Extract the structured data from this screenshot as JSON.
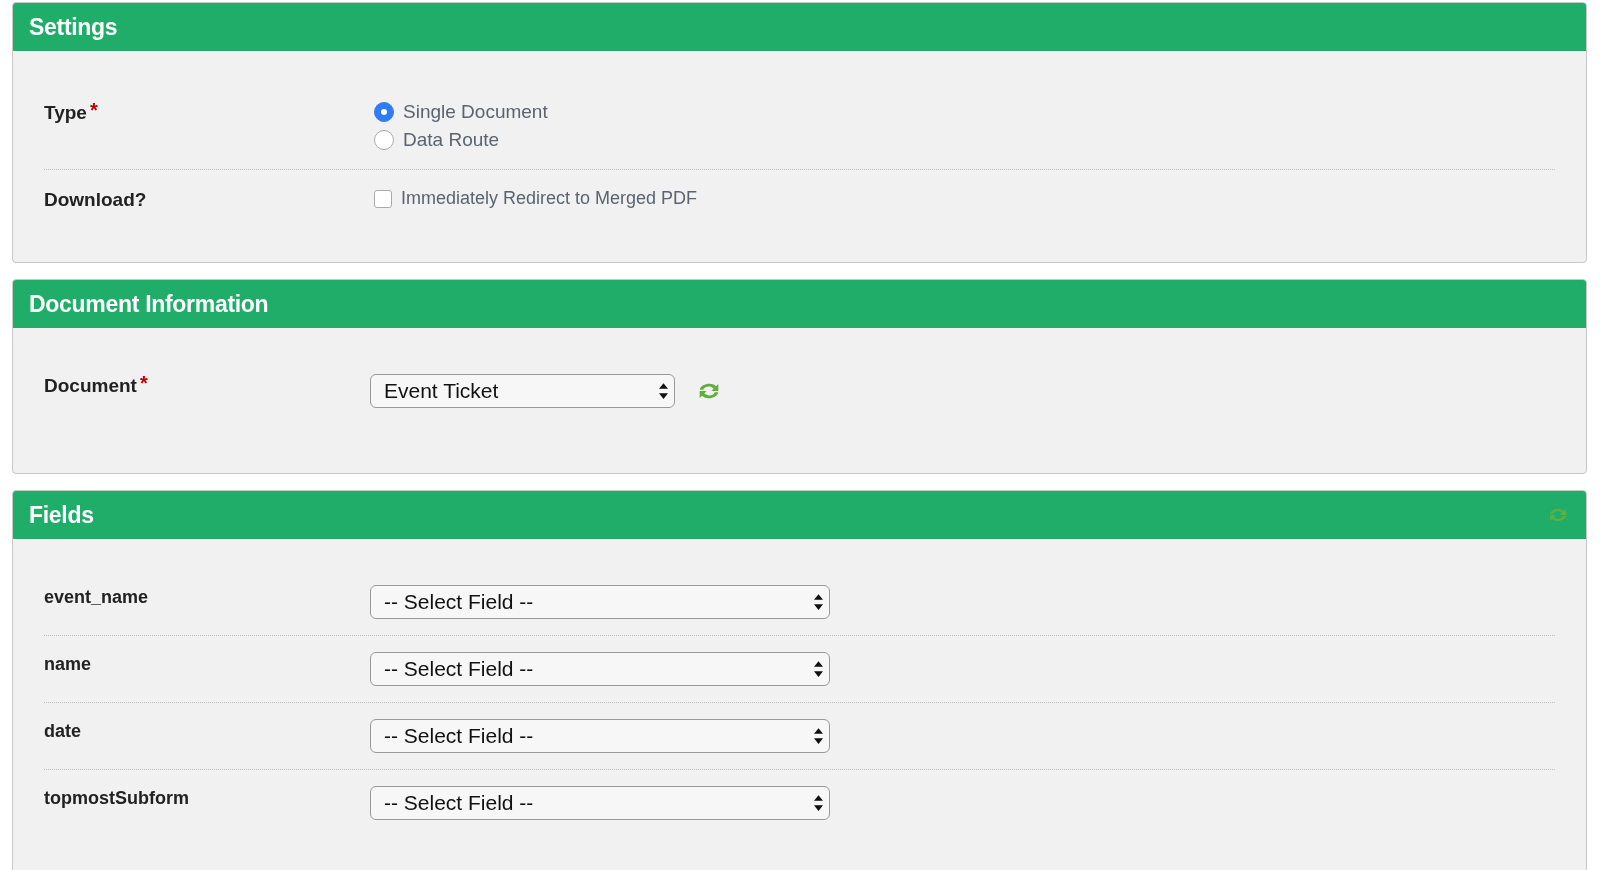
{
  "settings": {
    "title": "Settings",
    "type": {
      "label": "Type",
      "required_mark": "*",
      "options": [
        {
          "label": "Single Document",
          "selected": true
        },
        {
          "label": "Data Route",
          "selected": false
        }
      ]
    },
    "download": {
      "label": "Download?",
      "option": {
        "label": "Immediately Redirect to Merged PDF",
        "checked": false
      }
    }
  },
  "document_information": {
    "title": "Document Information",
    "document": {
      "label": "Document",
      "required_mark": "*",
      "value": "Event Ticket"
    }
  },
  "fields": {
    "title": "Fields",
    "rows": [
      {
        "label": "event_name",
        "value": "-- Select Field --"
      },
      {
        "label": "name",
        "value": "-- Select Field --"
      },
      {
        "label": "date",
        "value": "-- Select Field --"
      },
      {
        "label": "topmostSubform",
        "value": "-- Select Field --"
      }
    ]
  }
}
